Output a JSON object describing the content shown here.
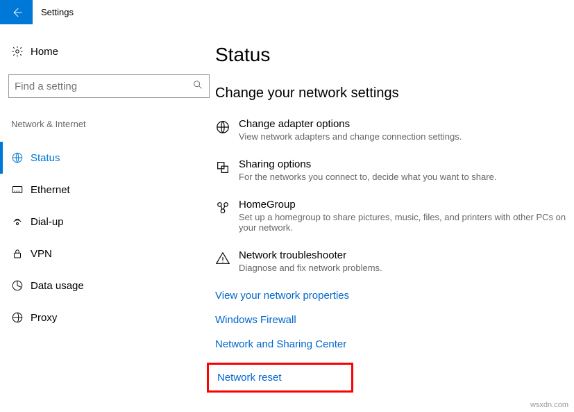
{
  "window": {
    "title": "Settings"
  },
  "sidebar": {
    "home": "Home",
    "search_placeholder": "Find a setting",
    "category": "Network & Internet",
    "items": [
      {
        "label": "Status"
      },
      {
        "label": "Ethernet"
      },
      {
        "label": "Dial-up"
      },
      {
        "label": "VPN"
      },
      {
        "label": "Data usage"
      },
      {
        "label": "Proxy"
      }
    ]
  },
  "main": {
    "title": "Status",
    "section_title": "Change your network settings",
    "options": [
      {
        "title": "Change adapter options",
        "desc": "View network adapters and change connection settings."
      },
      {
        "title": "Sharing options",
        "desc": "For the networks you connect to, decide what you want to share."
      },
      {
        "title": "HomeGroup",
        "desc": "Set up a homegroup to share pictures, music, files, and printers with other PCs on your network."
      },
      {
        "title": "Network troubleshooter",
        "desc": "Diagnose and fix network problems."
      }
    ],
    "links": [
      "View your network properties",
      "Windows Firewall",
      "Network and Sharing Center",
      "Network reset"
    ]
  },
  "watermark": "wsxdn.com"
}
